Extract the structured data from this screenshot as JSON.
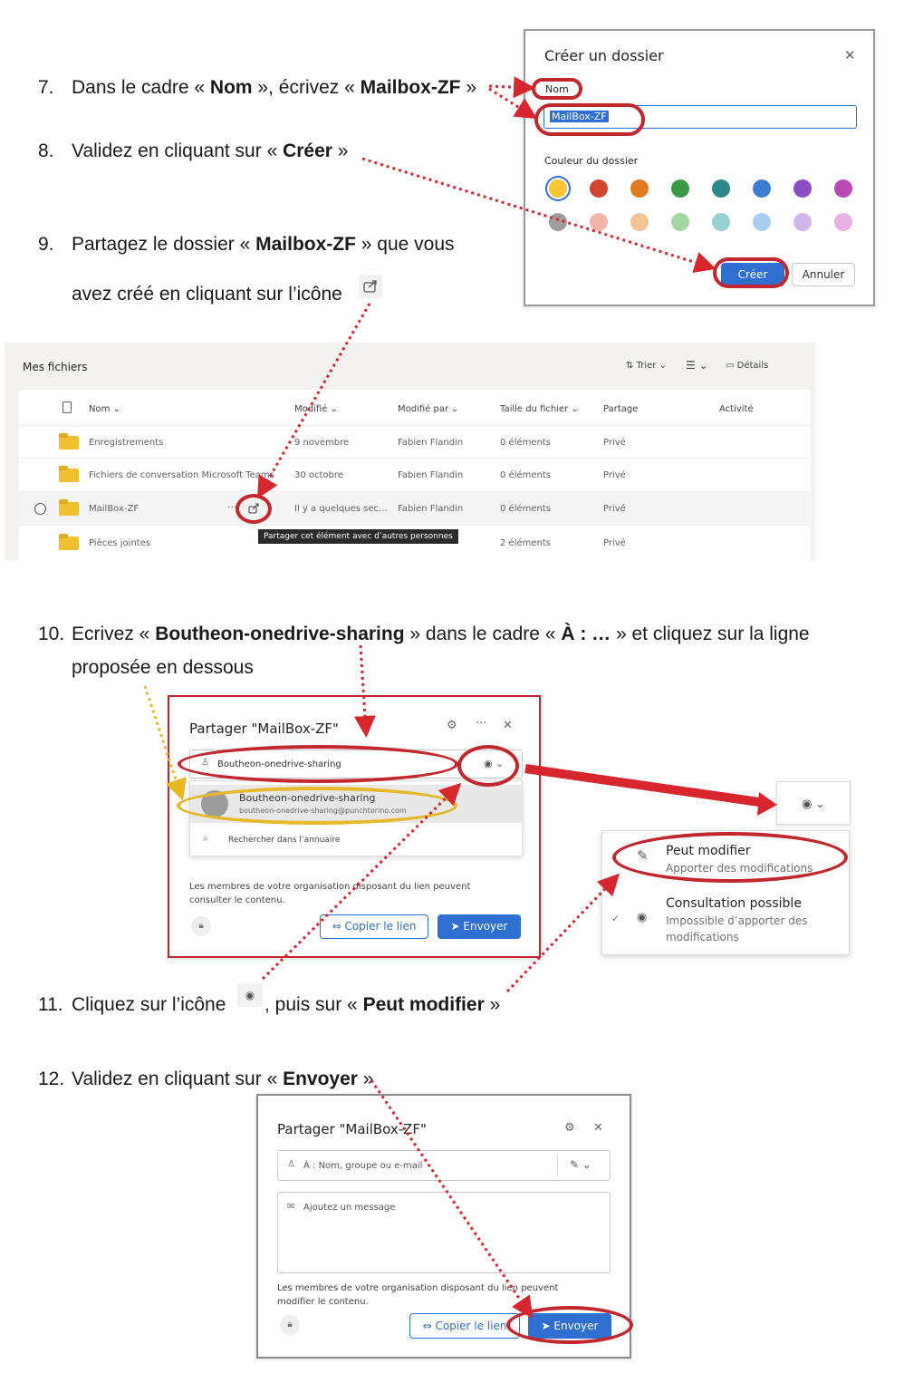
{
  "steps": {
    "s7": {
      "num": "7.",
      "pre": "Dans le cadre « ",
      "b1": "Nom",
      "mid": " », écrivez « ",
      "b2": "Mailbox-ZF",
      "post": " »"
    },
    "s8": {
      "num": "8.",
      "pre": "Validez en cliquant sur « ",
      "b1": "Créer",
      "post": " »"
    },
    "s9": {
      "num": "9.",
      "pre": "Partagez le dossier « ",
      "b1": "Mailbox-ZF",
      "post": " » que vous",
      "line2": "avez créé en cliquant sur l’icône"
    },
    "s10": {
      "num": "10.",
      "pre": "Ecrivez « ",
      "b1": "Boutheon-onedrive-sharing",
      "mid": " » dans le cadre « ",
      "b2": "À : …",
      "post": " » et cliquez sur la ligne",
      "line2": "proposée en dessous"
    },
    "s11": {
      "num": "11.",
      "pre": "Cliquez sur l’icône",
      "mid": ", puis sur « ",
      "b1": "Peut modifier",
      "post": " »"
    },
    "s12": {
      "num": "12.",
      "pre": "Validez en cliquant sur « ",
      "b1": "Envoyer",
      "post": " »"
    }
  },
  "create_folder_dialog": {
    "title": "Créer un dossier",
    "name_label": "Nom",
    "name_value": "MailBox-ZF",
    "color_label": "Couleur du dossier",
    "colors_row1": [
      "#f6c636",
      "#d2452e",
      "#e07b1f",
      "#3a9a46",
      "#2e8a8a",
      "#3a7fd5",
      "#8d4ec5",
      "#b949b5"
    ],
    "colors_row2": [
      "#9e9e9e",
      "#f2b5a8",
      "#f2c394",
      "#a3d6a0",
      "#97d2d1",
      "#a9cdf2",
      "#d3b6ee",
      "#e8b2e4"
    ],
    "create_label": "Créer",
    "cancel_label": "Annuler"
  },
  "files": {
    "title": "Mes fichiers",
    "sort_label": "Trier",
    "details_label": "Détails",
    "columns": [
      "Nom",
      "Modifié",
      "Modifié par",
      "Taille du fichier",
      "Partage",
      "Activité"
    ],
    "rows": [
      {
        "name": "Enregistrements",
        "modified": "9 novembre",
        "by": "Fabien Flandin",
        "size": "0 éléments",
        "share": "Privé"
      },
      {
        "name": "Fichiers de conversation Microsoft Teams",
        "modified": "30 octobre",
        "by": "Fabien Flandin",
        "size": "0 éléments",
        "share": "Privé"
      },
      {
        "name": "MailBox-ZF",
        "modified": "Il y a quelques sec...",
        "by": "Fabien Flandin",
        "size": "0 éléments",
        "share": "Privé"
      },
      {
        "name": "Pièces jointes",
        "modified": "",
        "by": "",
        "size": "2 éléments",
        "share": "Privé"
      }
    ],
    "tooltip": "Partager cet élément avec d’autres personnes"
  },
  "share_dialog_1": {
    "title": "Partager \"MailBox-ZF\"",
    "input_value": "Boutheon-onedrive-sharing",
    "suggestion_name": "Boutheon-onedrive-sharing",
    "suggestion_email": "boutheon-onedrive-sharing@punchtorino.com",
    "directory_search": "Rechercher dans l’annuaire",
    "info": "Les membres de votre organisation disposant du lien peuvent consulter le contenu.",
    "copy_link": "Copier le lien",
    "send": "Envoyer"
  },
  "permission_menu": {
    "edit_title": "Peut modifier",
    "edit_desc": "Apporter des modifications",
    "view_title": "Consultation possible",
    "view_desc1": "Impossible d’apporter des",
    "view_desc2": "modifications"
  },
  "share_dialog_2": {
    "title": "Partager \"MailBox-ZF\"",
    "to_placeholder": "À : Nom, groupe ou e-mail",
    "message_placeholder": "Ajoutez un message",
    "info": "Les membres de votre organisation disposant du lien peuvent modifier le contenu.",
    "copy_link": "Copier le lien",
    "send": "Envoyer"
  }
}
